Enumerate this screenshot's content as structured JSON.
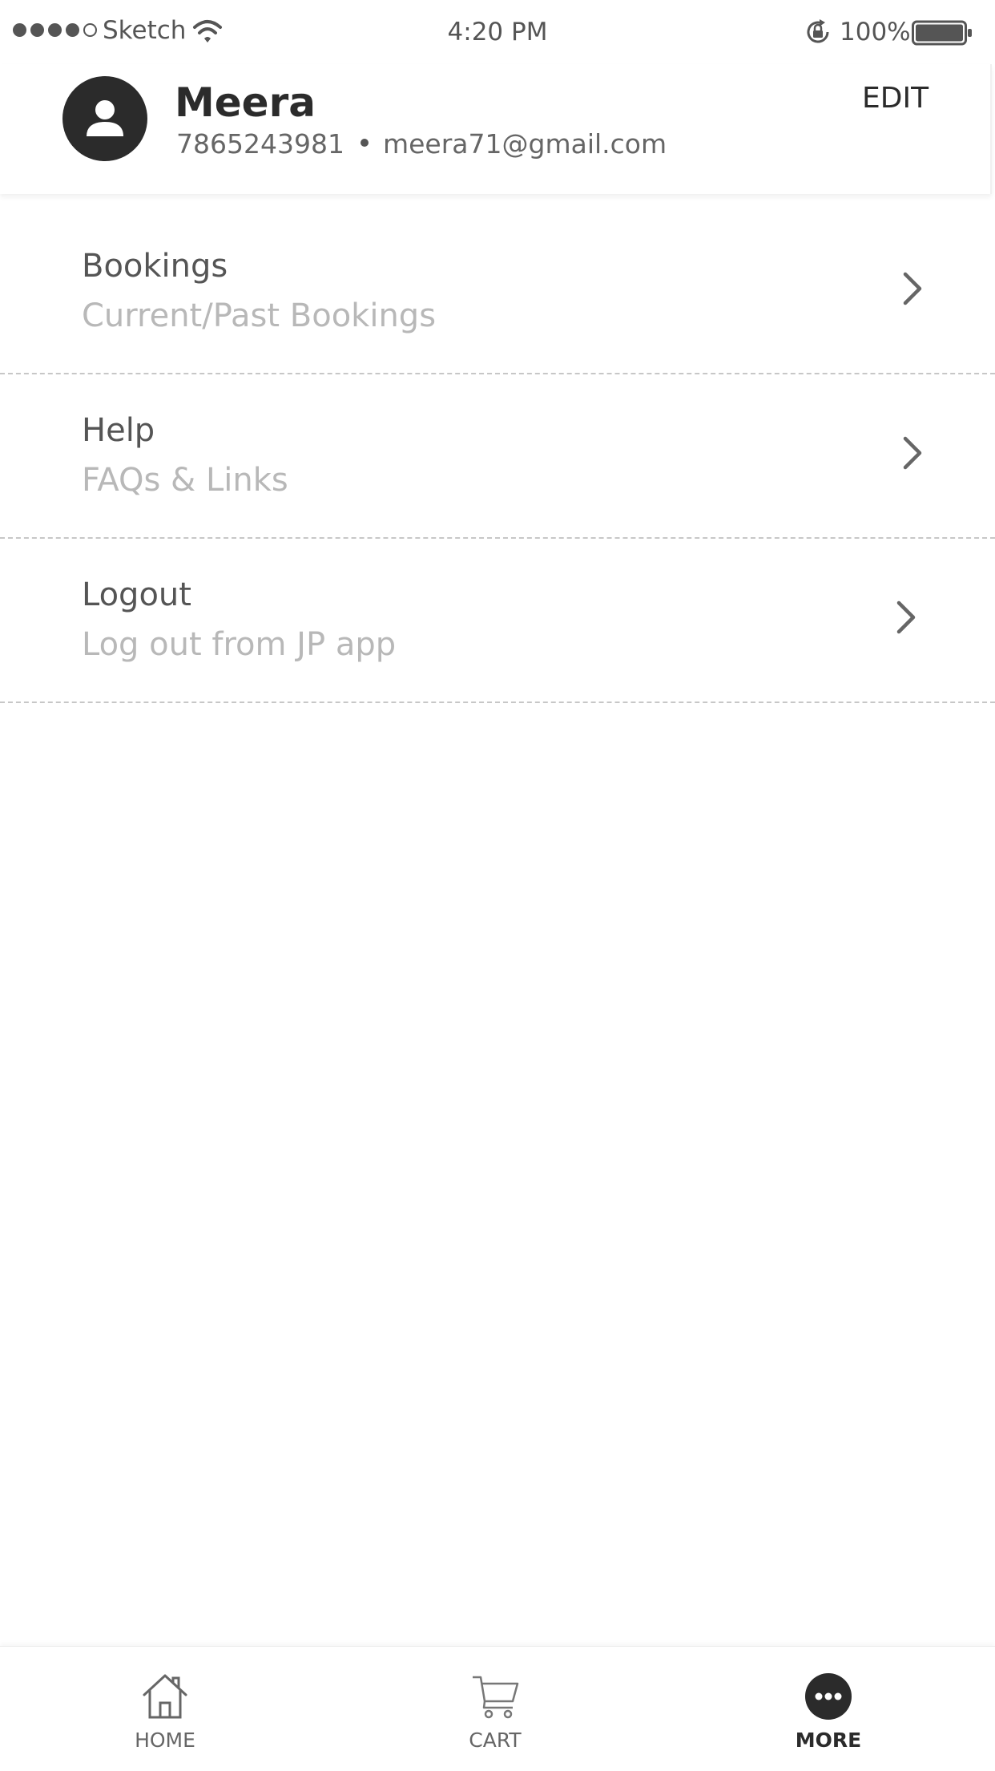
{
  "status_bar": {
    "carrier": "Sketch",
    "time": "4:20 PM",
    "battery": "100%",
    "signal_bars_filled": 4,
    "signal_bars_total": 5,
    "battery_level": 1.0
  },
  "profile": {
    "name": "Meera",
    "phone": "7865243981",
    "email": "meera71@gmail.com",
    "edit_label": "EDIT"
  },
  "menu": {
    "items": [
      {
        "title": "Bookings",
        "subtitle": "Current/Past Bookings",
        "icon": "chevron-right-icon"
      },
      {
        "title": "Help",
        "subtitle": "FAQs & Links",
        "icon": "chevron-right-icon"
      },
      {
        "title": "Logout",
        "subtitle": "Log out from JP app",
        "icon": "chevron-right-icon"
      }
    ]
  },
  "bottom_nav": {
    "items": [
      {
        "label": "HOME",
        "icon": "home-icon",
        "active": false
      },
      {
        "label": "CART",
        "icon": "cart-icon",
        "active": false
      },
      {
        "label": "MORE",
        "icon": "more-icon",
        "active": true
      }
    ]
  },
  "colors": {
    "primary_dark": "#2b2b2b",
    "text_gray": "#555555",
    "subtitle_gray": "#b8b8b8",
    "divider": "#c7c7c7"
  }
}
